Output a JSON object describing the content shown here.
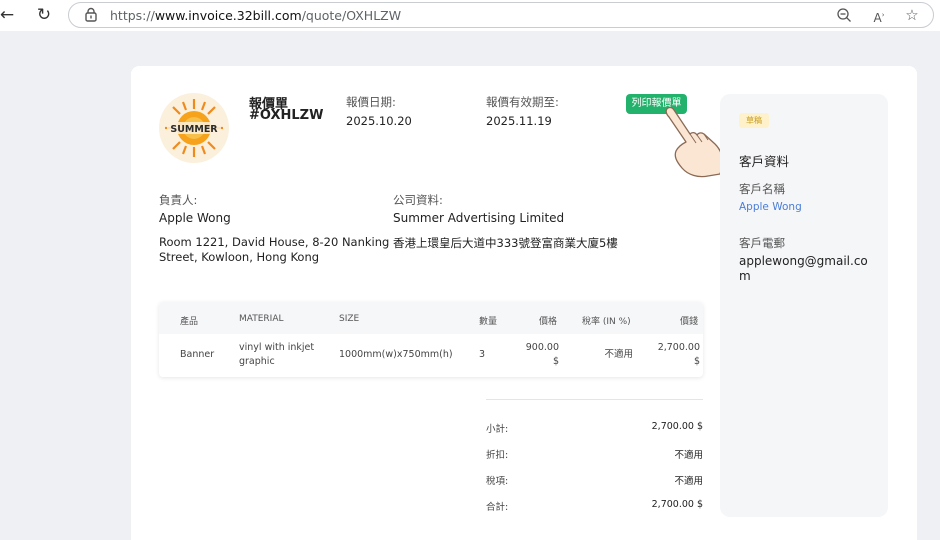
{
  "browser": {
    "url_prefix": "https://",
    "url_host": "www.invoice.32bill.com",
    "url_path": "/quote/OXHLZW",
    "icons": [
      "back-icon",
      "reload-icon",
      "lock-icon",
      "zoom-out-icon",
      "read-aloud-icon",
      "favorite-star-icon"
    ]
  },
  "quote": {
    "logo_text": "SUMMER",
    "title": "報價單",
    "number": "#OXHLZW",
    "date_label": "報價日期:",
    "date": "2025.10.20",
    "valid_label": "報價有效期至:",
    "valid_until": "2025.11.19",
    "print_button": "列印報價單"
  },
  "owner": {
    "label": "負責人:",
    "name": "Apple Wong",
    "address_line1": "Room 1221, David House, 8-20 Nanking",
    "address_line2": "Street, Kowloon, Hong Kong"
  },
  "company": {
    "label": "公司資料:",
    "name": "Summer Advertising Limited",
    "address": "香港上環皇后大道中333號登富商業大廈5樓"
  },
  "items": {
    "headers": [
      "產品",
      "MATERIAL",
      "SIZE",
      "數量",
      "價格",
      "稅率 (IN %)",
      "價錢"
    ],
    "rows": [
      {
        "product": "Banner",
        "material_line1": "vinyl with inkjet",
        "material_line2": "graphic",
        "size": "1000mm(w)x750mm(h)",
        "qty": "3",
        "price_line1": "900.00",
        "price_line2": "$",
        "tax": "不適用",
        "amount_line1": "2,700.00",
        "amount_line2": "$"
      }
    ]
  },
  "totals": [
    {
      "label": "小計:",
      "value": "2,700.00 $"
    },
    {
      "label": "折扣:",
      "value": "不適用"
    },
    {
      "label": "稅項:",
      "value": "不適用"
    },
    {
      "label": "合計:",
      "value": "2,700.00 $"
    }
  ],
  "customer": {
    "status_badge": "草稿",
    "section_title": "客戶資料",
    "name_label": "客戶名稱",
    "name": "Apple Wong",
    "phone_label": "客戶電郵",
    "email": "applewong@gmail.com"
  },
  "colors": {
    "accent_green": "#22b26b",
    "link_blue": "#4a7dd8",
    "badge_yellow": "#fff1c9"
  }
}
